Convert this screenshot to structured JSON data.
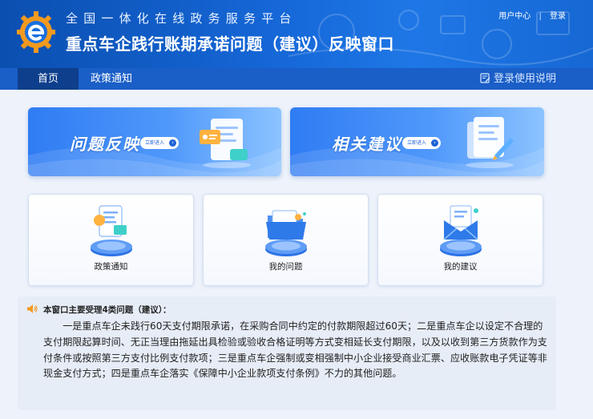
{
  "header": {
    "site_title": "全国一体化在线政务服务平台",
    "page_title": "重点车企践行账期承诺问题（建议）反映窗口",
    "user_center": "用户中心",
    "separator": "|",
    "login": "登录"
  },
  "nav": {
    "items": [
      {
        "label": "首页",
        "active": true
      },
      {
        "label": "政策通知",
        "active": false
      }
    ],
    "help_label": "登录使用说明"
  },
  "banners": [
    {
      "title": "问题反映",
      "button": "立即进入"
    },
    {
      "title": "相关建议",
      "button": "立即进入"
    }
  ],
  "tiles": [
    {
      "label": "政策通知",
      "icon": "policy-document-icon"
    },
    {
      "label": "我的问题",
      "icon": "folder-icon"
    },
    {
      "label": "我的建议",
      "icon": "envelope-icon"
    }
  ],
  "notice": {
    "icon": "speaker-icon",
    "title": "本窗口主要受理4类问题（建议）：",
    "body": "一是重点车企未践行60天支付期限承诺，在采购合同中约定的付款期限超过60天；二是重点车企以设定不合理的支付期限起算时间、无正当理由拖延出具检验或验收合格证明等方式变相延长支付期限，以及以收到第三方货款作为支付条件或按照第三方支付比例支付款项；三是重点车企强制或变相强制中小企业接受商业汇票、应收账款电子凭证等非现金支付方式；四是重点车企落实《保障中小企业款项支付条例》不力的其他问题。"
  },
  "colors": {
    "header_blue": "#1566d6",
    "nav_blue": "#1a5ec7",
    "nav_active": "#0e3f8c",
    "logo_orange": "#f39a1e",
    "notice_orange": "#f39a1e"
  }
}
